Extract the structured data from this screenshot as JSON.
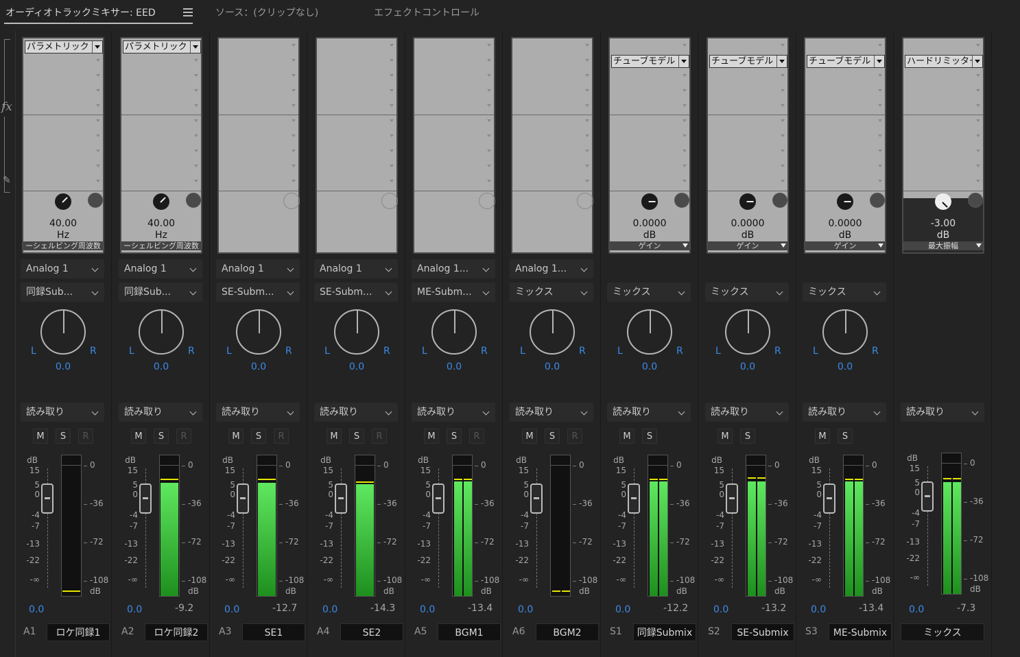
{
  "tabs": [
    {
      "label": "オーディオトラックミキサー: EED",
      "active": true
    },
    {
      "label": "ソース：(クリップなし)",
      "active": false
    },
    {
      "label": "エフェクトコントロール",
      "active": false
    }
  ],
  "colors": {
    "accent": "#3c8ae8",
    "meter_green": "#3fd23f",
    "peak_line": "#e6e600",
    "background": "#232323"
  },
  "channels": [
    {
      "id": "A1",
      "name": "ロケ同録1",
      "effect": "パラメトリック",
      "param_value": "40.00",
      "param_unit": "Hz",
      "param_label": "ーシェルビング周波数",
      "rack_style": "light",
      "input": "Analog 1",
      "output": "同録Sub...",
      "pan": "0.0",
      "auto": "読み取り",
      "show_r": true,
      "volume": "0.0",
      "peak": "",
      "meter_level": [
        0.0
      ],
      "peak_line": [
        0.03
      ]
    },
    {
      "id": "A2",
      "name": "ロケ同録2",
      "effect": "パラメトリック",
      "param_value": "40.00",
      "param_unit": "Hz",
      "param_label": "ーシェルビング周波数",
      "rack_style": "light",
      "input": "Analog 1",
      "output": "同録Sub...",
      "pan": "0.0",
      "auto": "読み取り",
      "show_r": true,
      "volume": "0.0",
      "peak": "-9.2",
      "meter_level": [
        0.87
      ],
      "peak_line": [
        0.89
      ]
    },
    {
      "id": "A3",
      "name": "SE1",
      "effect": "",
      "param_value": "",
      "param_unit": "",
      "param_label": "",
      "rack_style": "empty",
      "input": "Analog 1",
      "output": "SE-Subm...",
      "pan": "0.0",
      "auto": "読み取り",
      "show_r": true,
      "volume": "0.0",
      "peak": "-12.7",
      "meter_level": [
        0.87
      ],
      "peak_line": [
        0.89
      ]
    },
    {
      "id": "A4",
      "name": "SE2",
      "effect": "",
      "param_value": "",
      "param_unit": "",
      "param_label": "",
      "rack_style": "empty",
      "input": "Analog 1",
      "output": "SE-Subm...",
      "pan": "0.0",
      "auto": "読み取り",
      "show_r": true,
      "volume": "0.0",
      "peak": "-14.3",
      "meter_level": [
        0.86
      ],
      "peak_line": [
        0.87
      ]
    },
    {
      "id": "A5",
      "name": "BGM1",
      "effect": "",
      "param_value": "",
      "param_unit": "",
      "param_label": "",
      "rack_style": "empty",
      "input": "Analog 1...",
      "output": "ME-Subm...",
      "pan": "0.0",
      "auto": "読み取り",
      "show_r": true,
      "volume": "0.0",
      "peak": "-13.4",
      "meter_level": [
        0.88,
        0.88
      ],
      "peak_line": [
        0.89,
        0.89
      ]
    },
    {
      "id": "A6",
      "name": "BGM2",
      "effect": "",
      "param_value": "",
      "param_unit": "",
      "param_label": "",
      "rack_style": "empty",
      "input": "Analog 1...",
      "output": "ミックス",
      "pan": "0.0",
      "auto": "読み取り",
      "show_r": true,
      "volume": "0.0",
      "peak": "",
      "meter_level": [
        0.0,
        0.0
      ],
      "peak_line": [
        0.03,
        0.03
      ]
    },
    {
      "id": "S1",
      "name": "同録Submix",
      "effect": "チューブモデル",
      "param_value": "0.0000",
      "param_unit": "dB",
      "param_label": "ゲイン",
      "rack_style": "light",
      "input": "",
      "output": "ミックス",
      "pan": "0.0",
      "auto": "読み取り",
      "show_r": false,
      "volume": "0.0",
      "peak": "-12.2",
      "meter_level": [
        0.88,
        0.88
      ],
      "peak_line": [
        0.89,
        0.89
      ]
    },
    {
      "id": "S2",
      "name": "SE-Submix",
      "effect": "チューブモデル",
      "param_value": "0.0000",
      "param_unit": "dB",
      "param_label": "ゲイン",
      "rack_style": "light",
      "input": "",
      "output": "ミックス",
      "pan": "0.0",
      "auto": "読み取り",
      "show_r": false,
      "volume": "0.0",
      "peak": "-13.2",
      "meter_level": [
        0.88,
        0.88
      ],
      "peak_line": [
        0.9,
        0.9
      ]
    },
    {
      "id": "S3",
      "name": "ME-Submix",
      "effect": "チューブモデル",
      "param_value": "0.0000",
      "param_unit": "dB",
      "param_label": "ゲイン",
      "rack_style": "light",
      "input": "",
      "output": "ミックス",
      "pan": "0.0",
      "auto": "読み取り",
      "show_r": false,
      "volume": "0.0",
      "peak": "-13.4",
      "meter_level": [
        0.88,
        0.88
      ],
      "peak_line": [
        0.89,
        0.89
      ]
    },
    {
      "id": "",
      "name": "ミックス",
      "effect": "ハードリミッター",
      "param_value": "-3.00",
      "param_unit": "dB",
      "param_label": "最大振幅",
      "rack_style": "dark",
      "input": "",
      "output": "",
      "pan": "",
      "auto": "読み取り",
      "show_r": false,
      "volume": "0.0",
      "peak": "-7.3",
      "meter_level": [
        0.86,
        0.86
      ],
      "peak_line": [
        0.88,
        0.88
      ],
      "master": true
    }
  ],
  "fader_scale": [
    "dB",
    "15",
    "5",
    "0",
    "-4",
    "-7",
    "-13",
    "-22",
    "-∞"
  ],
  "meter_scale": [
    "0",
    "-36",
    "-72",
    "-108",
    "dB"
  ]
}
